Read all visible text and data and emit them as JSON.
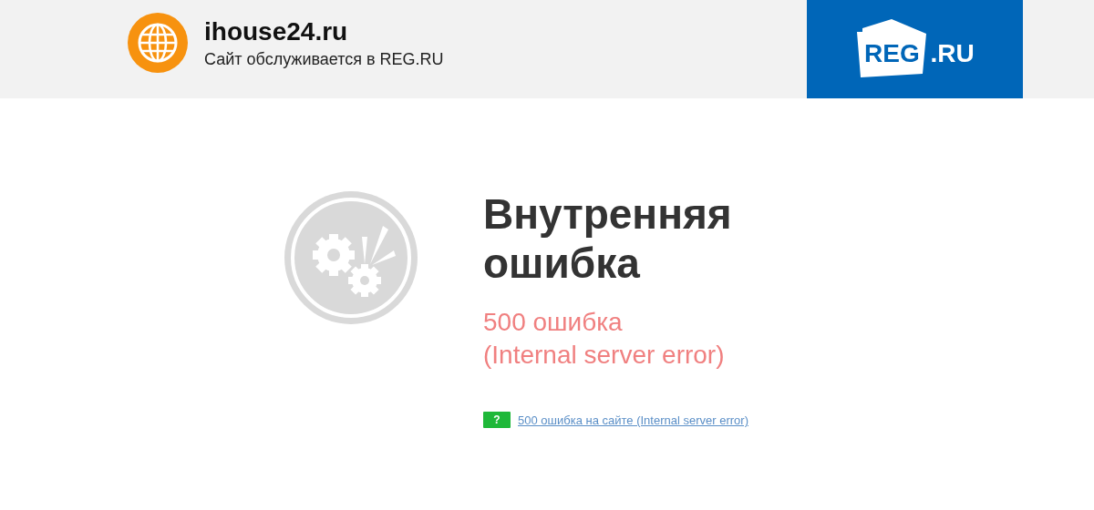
{
  "header": {
    "site_name": "ihouse24.ru",
    "subtitle": "Сайт обслуживается в REG.RU",
    "logo": {
      "part_1": "REG",
      "part_2": ".RU"
    }
  },
  "error": {
    "title_lines": [
      "Внутренняя",
      "ошибка"
    ],
    "code_lines": [
      "500 ошибка",
      "(Internal server error)"
    ],
    "help": {
      "icon_text": "?",
      "link": "500 ошибка на сайте (Internal server error)"
    }
  }
}
